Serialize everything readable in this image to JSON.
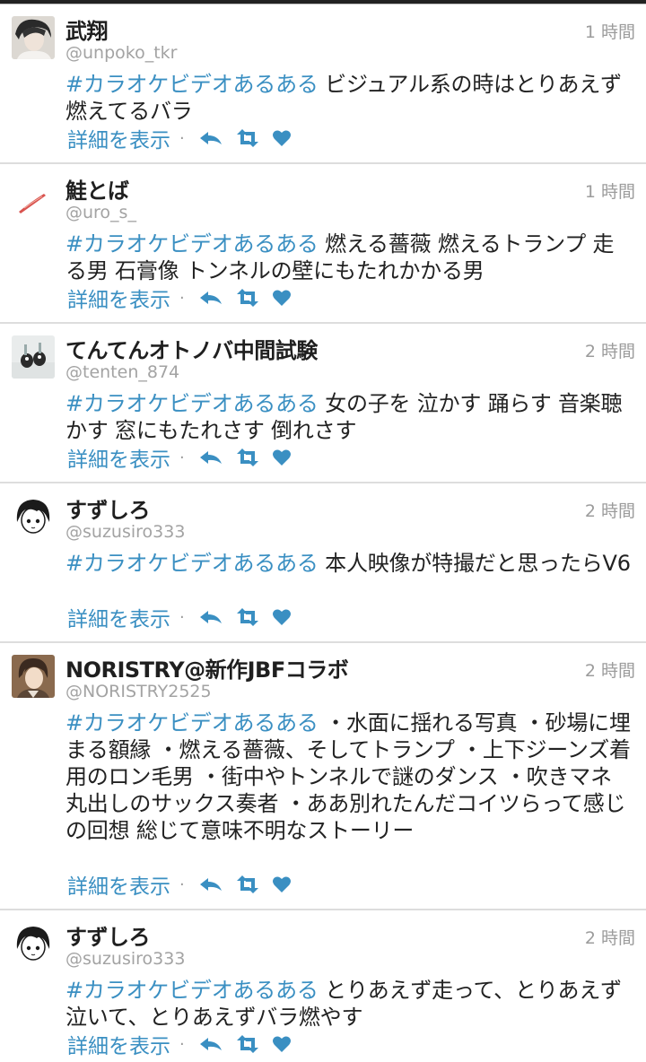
{
  "ui": {
    "details_label": "詳細を表示",
    "separator": "·",
    "hashtag_color": "#3a8fc2",
    "icons": [
      "reply-icon",
      "retweet-icon",
      "favorite-icon"
    ]
  },
  "tweets": [
    {
      "name": "武翔",
      "handle": "@unpoko_tkr",
      "time": "1 時間",
      "hashtag": "#カラオケビデオあるある",
      "text": " ビジュアル系の時はとりあえず燃えてるバラ"
    },
    {
      "name": "鮭とば",
      "handle": "@uro_s_",
      "time": "1 時間",
      "hashtag": "#カラオケビデオあるある",
      "text": " 燃える薔薇 燃えるトランプ 走る男 石膏像 トンネルの壁にもたれかかる男"
    },
    {
      "name": "てんてんオトノバ中間試験",
      "handle": "@tenten_874",
      "time": "2 時間",
      "hashtag": "#カラオケビデオあるある",
      "text": " 女の子を 泣かす 踊らす 音楽聴かす 窓にもたれさす 倒れさす"
    },
    {
      "name": "すずしろ",
      "handle": "@suzusiro333",
      "time": "2 時間",
      "hashtag": "#カラオケビデオあるある",
      "text": " 本人映像が特撮だと思ったらV6"
    },
    {
      "name": "NORISTRY@新作JBFコラボ",
      "handle": "@NORISTRY2525",
      "time": "2 時間",
      "hashtag": "#カラオケビデオあるある",
      "text": " ・水面に揺れる写真 ・砂場に埋まる額縁 ・燃える薔薇、そしてトランプ ・上下ジーンズ着用のロン毛男 ・街中やトンネルで謎のダンス ・吹きマネ丸出しのサックス奏者 ・ああ別れたんだコイツらって感じの回想 総じて意味不明なストーリー"
    },
    {
      "name": "すずしろ",
      "handle": "@suzusiro333",
      "time": "2 時間",
      "hashtag": "#カラオケビデオあるある",
      "text": " とりあえず走って、とりあえず泣いて、とりあえずバラ燃やす"
    }
  ]
}
